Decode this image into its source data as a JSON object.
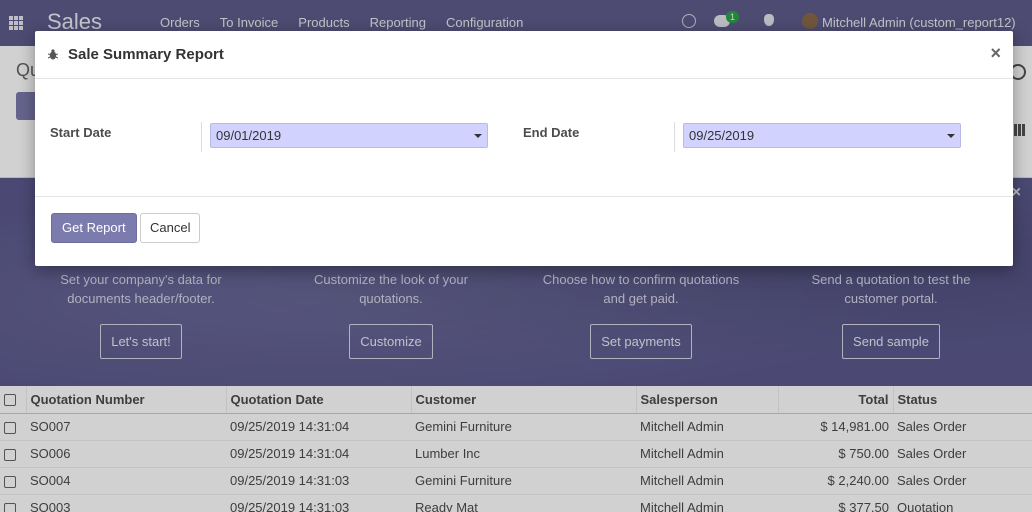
{
  "app": {
    "brand": "Sales",
    "menu": [
      "Orders",
      "To Invoice",
      "Products",
      "Reporting",
      "Configuration"
    ],
    "chat_count": "1",
    "user": "Mitchell Admin (custom_report12)"
  },
  "breadcrumb_partial": "Qu",
  "create_partial": "C",
  "banner": {
    "steps": [
      {
        "desc": "Set your company's data for documents header/footer.",
        "button": "Let's start!"
      },
      {
        "desc": "Customize the look of your quotations.",
        "button": "Customize"
      },
      {
        "desc": "Choose how to confirm quotations and get paid.",
        "button": "Set payments"
      },
      {
        "desc": "Send a quotation to test the customer portal.",
        "button": "Send sample"
      }
    ]
  },
  "table": {
    "headers": [
      "Quotation Number",
      "Quotation Date",
      "Customer",
      "Salesperson",
      "Total",
      "Status"
    ],
    "rows": [
      [
        "SO007",
        "09/25/2019 14:31:04",
        "Gemini Furniture",
        "Mitchell Admin",
        "$ 14,981.00",
        "Sales Order"
      ],
      [
        "SO006",
        "09/25/2019 14:31:04",
        "Lumber Inc",
        "Mitchell Admin",
        "$ 750.00",
        "Sales Order"
      ],
      [
        "SO004",
        "09/25/2019 14:31:03",
        "Gemini Furniture",
        "Mitchell Admin",
        "$ 2,240.00",
        "Sales Order"
      ],
      [
        "SO003",
        "09/25/2019 14:31:03",
        "Ready Mat",
        "Mitchell Admin",
        "$ 377.50",
        "Quotation"
      ]
    ]
  },
  "modal": {
    "title": "Sale Summary Report",
    "close": "×",
    "start_label": "Start Date",
    "start_value": "09/01/2019",
    "end_label": "End Date",
    "end_value": "09/25/2019",
    "get_report": "Get Report",
    "cancel": "Cancel"
  },
  "colors": {
    "navbar": "#5f5c8a",
    "primary_button": "#7c7bad",
    "date_field": "#d2d2ff"
  }
}
